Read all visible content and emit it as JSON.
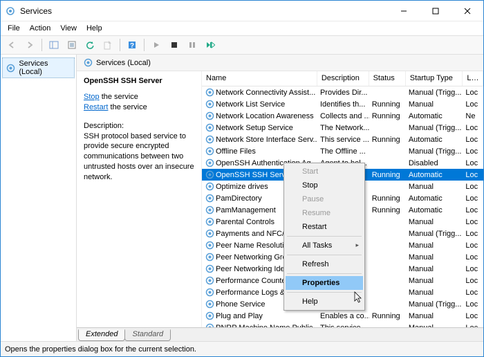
{
  "window": {
    "title": "Services"
  },
  "menu": {
    "file": "File",
    "action": "Action",
    "view": "View",
    "help": "Help"
  },
  "tree": {
    "root": "Services (Local)"
  },
  "view_header": "Services (Local)",
  "detail": {
    "service_name": "OpenSSH SSH Server",
    "stop_link": "Stop",
    "stop_suffix": " the service",
    "restart_link": "Restart",
    "restart_suffix": " the service",
    "desc_label": "Description:",
    "desc_body": "SSH protocol based service to provide secure encrypted communications between two untrusted hosts over an insecure network."
  },
  "columns": {
    "name": "Name",
    "description": "Description",
    "status": "Status",
    "startup": "Startup Type",
    "logon": "Loc"
  },
  "services": [
    {
      "name": "Network Connectivity Assist...",
      "desc": "Provides Dir...",
      "status": "",
      "startup": "Manual (Trigg...",
      "logon": "Loc"
    },
    {
      "name": "Network List Service",
      "desc": "Identifies th...",
      "status": "Running",
      "startup": "Manual",
      "logon": "Loc"
    },
    {
      "name": "Network Location Awareness",
      "desc": "Collects and ...",
      "status": "Running",
      "startup": "Automatic",
      "logon": "Ne"
    },
    {
      "name": "Network Setup Service",
      "desc": "The Network...",
      "status": "",
      "startup": "Manual (Trigg...",
      "logon": "Loc"
    },
    {
      "name": "Network Store Interface Serv...",
      "desc": "This service ...",
      "status": "Running",
      "startup": "Automatic",
      "logon": "Loc"
    },
    {
      "name": "Offline Files",
      "desc": "The Offline ...",
      "status": "",
      "startup": "Manual (Trigg...",
      "logon": "Loc"
    },
    {
      "name": "OpenSSH Authentication Ag...",
      "desc": "Agent to hol...",
      "status": "",
      "startup": "Disabled",
      "logon": "Loc"
    },
    {
      "name": "OpenSSH SSH Server",
      "desc": "",
      "status": "Running",
      "startup": "Automatic",
      "logon": "Loc",
      "selected": true
    },
    {
      "name": "Optimize drives",
      "desc": "",
      "status": "",
      "startup": "Manual",
      "logon": "Loc"
    },
    {
      "name": "PamDirectory",
      "desc": "",
      "status": "Running",
      "startup": "Automatic",
      "logon": "Loc"
    },
    {
      "name": "PamManagement",
      "desc": "",
      "status": "Running",
      "startup": "Automatic",
      "logon": "Loc"
    },
    {
      "name": "Parental Controls",
      "desc": "",
      "status": "",
      "startup": "Manual",
      "logon": "Loc"
    },
    {
      "name": "Payments and NFC/S",
      "desc": "",
      "status": "",
      "startup": "Manual (Trigg...",
      "logon": "Loc"
    },
    {
      "name": "Peer Name Resolutio",
      "desc": "",
      "status": "",
      "startup": "Manual",
      "logon": "Loc"
    },
    {
      "name": "Peer Networking Gro",
      "desc": "",
      "status": "",
      "startup": "Manual",
      "logon": "Loc"
    },
    {
      "name": "Peer Networking Ide",
      "desc": "",
      "status": "",
      "startup": "Manual",
      "logon": "Loc"
    },
    {
      "name": "Performance Counter",
      "desc": "",
      "status": "",
      "startup": "Manual",
      "logon": "Loc"
    },
    {
      "name": "Performance Logs & A",
      "desc": "",
      "status": "",
      "startup": "Manual",
      "logon": "Loc"
    },
    {
      "name": "Phone Service",
      "desc": "",
      "status": "",
      "startup": "Manual (Trigg...",
      "logon": "Loc"
    },
    {
      "name": "Plug and Play",
      "desc": "Enables a co...",
      "status": "Running",
      "startup": "Manual",
      "logon": "Loc"
    },
    {
      "name": "PNRP Machine Name Public...",
      "desc": "This service ...",
      "status": "",
      "startup": "Manual",
      "logon": "Loc"
    }
  ],
  "context_menu": {
    "start": "Start",
    "stop": "Stop",
    "pause": "Pause",
    "resume": "Resume",
    "restart": "Restart",
    "all_tasks": "All Tasks",
    "refresh": "Refresh",
    "properties": "Properties",
    "help": "Help"
  },
  "tabs": {
    "extended": "Extended",
    "standard": "Standard"
  },
  "statusbar": "Opens the properties dialog box for the current selection."
}
